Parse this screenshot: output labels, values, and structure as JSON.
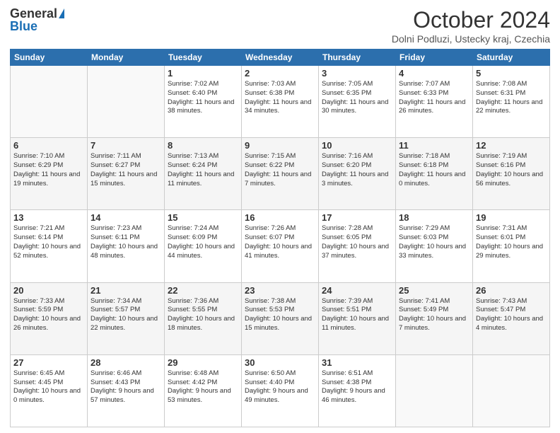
{
  "header": {
    "logo_general": "General",
    "logo_blue": "Blue",
    "month": "October 2024",
    "location": "Dolni Podluzi, Ustecky kraj, Czechia"
  },
  "days_of_week": [
    "Sunday",
    "Monday",
    "Tuesday",
    "Wednesday",
    "Thursday",
    "Friday",
    "Saturday"
  ],
  "weeks": [
    [
      {
        "day": "",
        "info": ""
      },
      {
        "day": "",
        "info": ""
      },
      {
        "day": "1",
        "info": "Sunrise: 7:02 AM\nSunset: 6:40 PM\nDaylight: 11 hours and 38 minutes."
      },
      {
        "day": "2",
        "info": "Sunrise: 7:03 AM\nSunset: 6:38 PM\nDaylight: 11 hours and 34 minutes."
      },
      {
        "day": "3",
        "info": "Sunrise: 7:05 AM\nSunset: 6:35 PM\nDaylight: 11 hours and 30 minutes."
      },
      {
        "day": "4",
        "info": "Sunrise: 7:07 AM\nSunset: 6:33 PM\nDaylight: 11 hours and 26 minutes."
      },
      {
        "day": "5",
        "info": "Sunrise: 7:08 AM\nSunset: 6:31 PM\nDaylight: 11 hours and 22 minutes."
      }
    ],
    [
      {
        "day": "6",
        "info": "Sunrise: 7:10 AM\nSunset: 6:29 PM\nDaylight: 11 hours and 19 minutes."
      },
      {
        "day": "7",
        "info": "Sunrise: 7:11 AM\nSunset: 6:27 PM\nDaylight: 11 hours and 15 minutes."
      },
      {
        "day": "8",
        "info": "Sunrise: 7:13 AM\nSunset: 6:24 PM\nDaylight: 11 hours and 11 minutes."
      },
      {
        "day": "9",
        "info": "Sunrise: 7:15 AM\nSunset: 6:22 PM\nDaylight: 11 hours and 7 minutes."
      },
      {
        "day": "10",
        "info": "Sunrise: 7:16 AM\nSunset: 6:20 PM\nDaylight: 11 hours and 3 minutes."
      },
      {
        "day": "11",
        "info": "Sunrise: 7:18 AM\nSunset: 6:18 PM\nDaylight: 11 hours and 0 minutes."
      },
      {
        "day": "12",
        "info": "Sunrise: 7:19 AM\nSunset: 6:16 PM\nDaylight: 10 hours and 56 minutes."
      }
    ],
    [
      {
        "day": "13",
        "info": "Sunrise: 7:21 AM\nSunset: 6:14 PM\nDaylight: 10 hours and 52 minutes."
      },
      {
        "day": "14",
        "info": "Sunrise: 7:23 AM\nSunset: 6:11 PM\nDaylight: 10 hours and 48 minutes."
      },
      {
        "day": "15",
        "info": "Sunrise: 7:24 AM\nSunset: 6:09 PM\nDaylight: 10 hours and 44 minutes."
      },
      {
        "day": "16",
        "info": "Sunrise: 7:26 AM\nSunset: 6:07 PM\nDaylight: 10 hours and 41 minutes."
      },
      {
        "day": "17",
        "info": "Sunrise: 7:28 AM\nSunset: 6:05 PM\nDaylight: 10 hours and 37 minutes."
      },
      {
        "day": "18",
        "info": "Sunrise: 7:29 AM\nSunset: 6:03 PM\nDaylight: 10 hours and 33 minutes."
      },
      {
        "day": "19",
        "info": "Sunrise: 7:31 AM\nSunset: 6:01 PM\nDaylight: 10 hours and 29 minutes."
      }
    ],
    [
      {
        "day": "20",
        "info": "Sunrise: 7:33 AM\nSunset: 5:59 PM\nDaylight: 10 hours and 26 minutes."
      },
      {
        "day": "21",
        "info": "Sunrise: 7:34 AM\nSunset: 5:57 PM\nDaylight: 10 hours and 22 minutes."
      },
      {
        "day": "22",
        "info": "Sunrise: 7:36 AM\nSunset: 5:55 PM\nDaylight: 10 hours and 18 minutes."
      },
      {
        "day": "23",
        "info": "Sunrise: 7:38 AM\nSunset: 5:53 PM\nDaylight: 10 hours and 15 minutes."
      },
      {
        "day": "24",
        "info": "Sunrise: 7:39 AM\nSunset: 5:51 PM\nDaylight: 10 hours and 11 minutes."
      },
      {
        "day": "25",
        "info": "Sunrise: 7:41 AM\nSunset: 5:49 PM\nDaylight: 10 hours and 7 minutes."
      },
      {
        "day": "26",
        "info": "Sunrise: 7:43 AM\nSunset: 5:47 PM\nDaylight: 10 hours and 4 minutes."
      }
    ],
    [
      {
        "day": "27",
        "info": "Sunrise: 6:45 AM\nSunset: 4:45 PM\nDaylight: 10 hours and 0 minutes."
      },
      {
        "day": "28",
        "info": "Sunrise: 6:46 AM\nSunset: 4:43 PM\nDaylight: 9 hours and 57 minutes."
      },
      {
        "day": "29",
        "info": "Sunrise: 6:48 AM\nSunset: 4:42 PM\nDaylight: 9 hours and 53 minutes."
      },
      {
        "day": "30",
        "info": "Sunrise: 6:50 AM\nSunset: 4:40 PM\nDaylight: 9 hours and 49 minutes."
      },
      {
        "day": "31",
        "info": "Sunrise: 6:51 AM\nSunset: 4:38 PM\nDaylight: 9 hours and 46 minutes."
      },
      {
        "day": "",
        "info": ""
      },
      {
        "day": "",
        "info": ""
      }
    ]
  ]
}
